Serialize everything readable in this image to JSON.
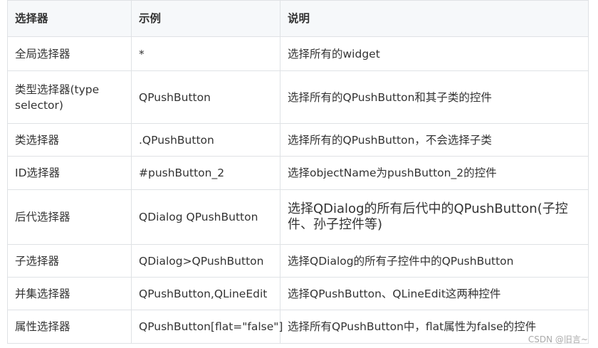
{
  "header": {
    "col1": "选择器",
    "col2": "示例",
    "col3": "说明"
  },
  "rows": [
    {
      "selector": "全局选择器",
      "example": "*",
      "desc": "选择所有的widget"
    },
    {
      "selector": "类型选择器(type selector)",
      "example": "QPushButton",
      "desc": "选择所有的QPushButton和其子类的控件"
    },
    {
      "selector": "类选择器",
      "example": ".QPushButton",
      "desc": "选择所有的QPushButton，不会选择子类"
    },
    {
      "selector": "ID选择器",
      "example": "#pushButton_2",
      "desc": "选择objectName为pushButton_2的控件"
    },
    {
      "selector": "后代选择器",
      "example": "QDialog QPushButton",
      "desc": "选择QDialog的所有后代中的QPushButton(子控件、孙子控件等)"
    },
    {
      "selector": "子选择器",
      "example": "QDialog>QPushButton",
      "desc": "选择QDialog的所有子控件中的QPushButton"
    },
    {
      "selector": "并集选择器",
      "example": "QPushButton,QLineEdit",
      "desc": "选择QPushButton、QLineEdit这两种控件"
    },
    {
      "selector": "属性选择器",
      "example": "QPushButton[flat=\"false\"]",
      "desc": "选择所有QPushButton中，flat属性为false的控件"
    }
  ],
  "watermark": "CSDN @旧言~"
}
